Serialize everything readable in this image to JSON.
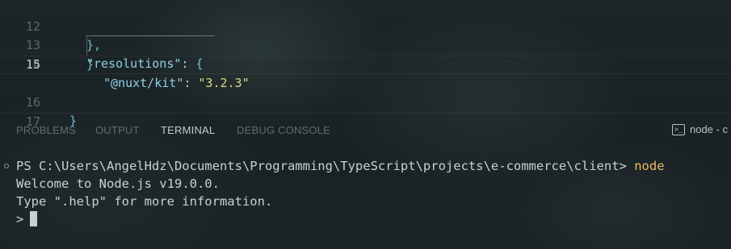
{
  "editor": {
    "lines": [
      {
        "number": "12",
        "text": "},"
      },
      {
        "number": "13",
        "key": "\"resolutions\"",
        "colon": ": ",
        "punct": "{"
      },
      {
        "number": "14",
        "key": "\"@nuxt/kit\"",
        "colon": ": ",
        "value": "\"3.2.3\""
      },
      {
        "number": "15",
        "punct": "}"
      },
      {
        "number": "16",
        "punct": "}"
      },
      {
        "number": "17",
        "text": ""
      }
    ]
  },
  "panel": {
    "tabs": [
      "PROBLEMS",
      "OUTPUT",
      "TERMINAL",
      "DEBUG CONSOLE"
    ],
    "active_tab": "TERMINAL",
    "terminal_select": "node - c",
    "terminal_icon": ">_"
  },
  "terminal": {
    "prompt": "PS C:\\Users\\AngelHdz\\Documents\\Programming\\TypeScript\\projects\\e-commerce\\client> ",
    "command": "node",
    "welcome": "Welcome to Node.js v19.0.0.",
    "help": "Type \".help\" for more information.",
    "repl_prompt": ">"
  },
  "colors": {
    "background": "#1a2226",
    "string": "#d9d88a",
    "key": "#8fd0e6",
    "command": "#e8b862"
  }
}
